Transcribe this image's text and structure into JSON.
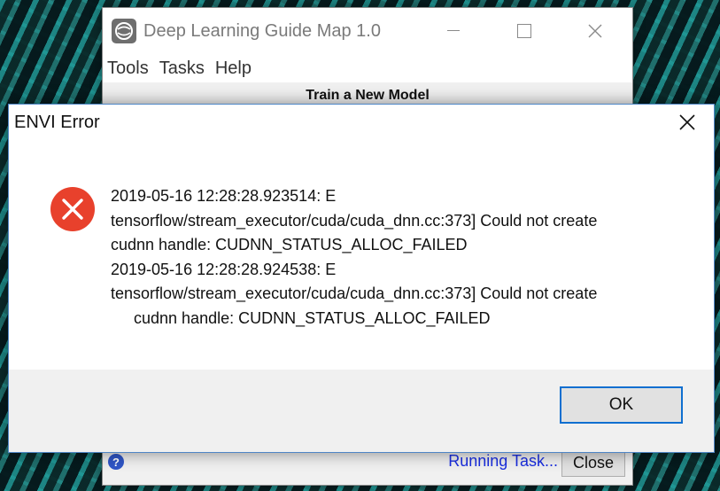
{
  "app_window": {
    "title": "Deep Learning Guide Map 1.0",
    "menu": [
      "Tools",
      "Tasks",
      "Help"
    ],
    "subtitle": "Train a New Model",
    "status_text": "Running Task...",
    "close_label": "Close",
    "help_glyph": "?"
  },
  "dialog": {
    "title": "ENVI Error",
    "close_glyph": "✕",
    "icon": "error-icon",
    "message_lines": [
      "2019-05-16 12:28:28.923514: E",
      "tensorflow/stream_executor/cuda/cuda_dnn.cc:373] Could not create",
      "cudnn handle: CUDNN_STATUS_ALLOC_FAILED",
      "2019-05-16 12:28:28.924538: E",
      "tensorflow/stream_executor/cuda/cuda_dnn.cc:373] Could not create",
      "cudnn handle: CUDNN_STATUS_ALLOC_FAILED"
    ],
    "ok_label": "OK"
  },
  "colors": {
    "error_red": "#e8412c",
    "link_blue": "#1a2ee0",
    "focus_blue": "#0f6fd0"
  }
}
